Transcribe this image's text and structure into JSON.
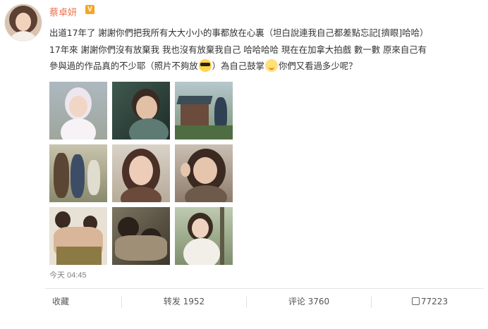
{
  "post": {
    "username": "蔡卓妍",
    "verified_badge": "V",
    "text_lines": [
      "出道17年了 謝謝你們把我所有大大小小的事都放在心裏（坦白說連我自己都差點忘記[擠眼]哈哈）",
      "17年來 謝謝你們沒有放棄我 我也沒有放棄我自己 哈哈哈哈 現在在加拿大拍戲 數一數 原來自己有",
      "參與過的作品真的不少耶（照片不夠放",
      "）為自己鼓掌",
      "你們又看過多少呢？"
    ],
    "emoji": [
      "sunglasses-emoji",
      "clap-emoji"
    ],
    "timestamp": "今天 04:45"
  },
  "actions": {
    "favorite": "收藏",
    "repost": "转发 1952",
    "comment": "评论 3760",
    "like": "77223"
  },
  "colors": {
    "username": "#eb7350",
    "badge": "#f5a623",
    "text": "#333333",
    "meta": "#808080"
  }
}
